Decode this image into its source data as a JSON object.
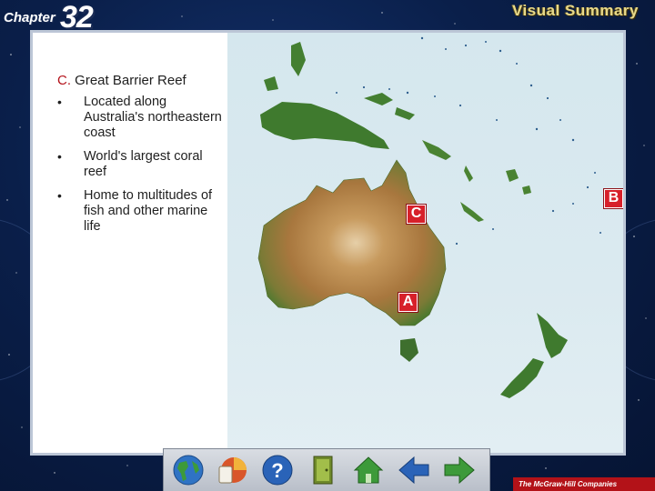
{
  "header": {
    "chapter_word": "Chapter",
    "chapter_number": "32",
    "section_title": "Visual Summary"
  },
  "content": {
    "heading_letter": "C.",
    "heading_text": "Great Barrier Reef",
    "bullet_symbol": "•",
    "bullets": [
      "Located along Australia's northeastern coast",
      "World's largest coral reef",
      "Home to multitudes of fish and other marine life"
    ]
  },
  "map": {
    "markers": {
      "a": "A",
      "b": "B",
      "c": "C"
    },
    "colors": {
      "ocean": "#dbeaf0",
      "desert": "#bf8a4c",
      "forest": "#3f7a2e",
      "marker": "#d7202a"
    }
  },
  "navigation": {
    "buttons": [
      "globe-icon",
      "resources-icon",
      "help-icon",
      "exit-door-icon",
      "home-icon",
      "back-arrow-icon",
      "forward-arrow-icon"
    ]
  },
  "footer": {
    "publisher": "The McGraw-Hill Companies"
  }
}
